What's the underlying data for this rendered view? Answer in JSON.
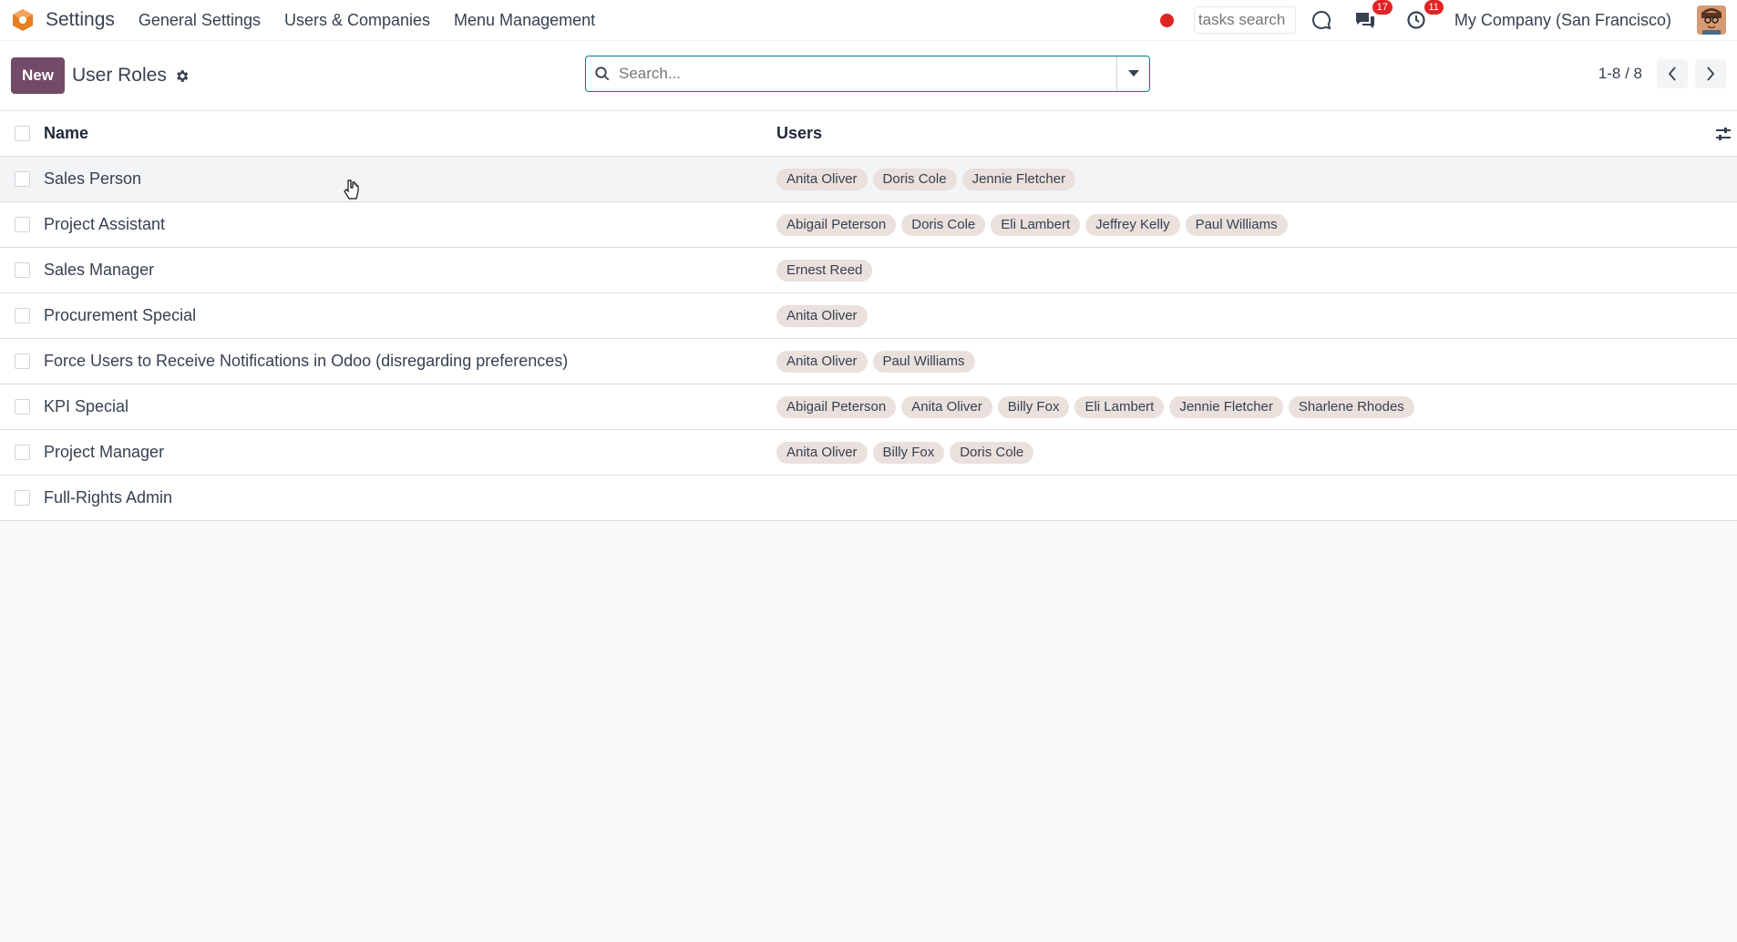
{
  "navbar": {
    "app_name": "Settings",
    "menu": [
      "General Settings",
      "Users & Companies",
      "Menu Management"
    ],
    "tasks_search_placeholder": "tasks search",
    "messages_badge": "17",
    "activities_badge": "11",
    "company": "My Company (San Francisco)"
  },
  "control": {
    "new_label": "New",
    "title": "User Roles",
    "search_placeholder": "Search...",
    "pager": "1-8 / 8"
  },
  "table": {
    "columns": [
      "Name",
      "Users"
    ],
    "rows": [
      {
        "name": "Sales Person",
        "users": [
          "Anita Oliver",
          "Doris Cole",
          "Jennie Fletcher"
        ]
      },
      {
        "name": "Project Assistant",
        "users": [
          "Abigail Peterson",
          "Doris Cole",
          "Eli Lambert",
          "Jeffrey Kelly",
          "Paul Williams"
        ]
      },
      {
        "name": "Sales Manager",
        "users": [
          "Ernest Reed"
        ]
      },
      {
        "name": "Procurement Special",
        "users": [
          "Anita Oliver"
        ]
      },
      {
        "name": "Force Users to Receive Notifications in Odoo (disregarding preferences)",
        "users": [
          "Anita Oliver",
          "Paul Williams"
        ]
      },
      {
        "name": "KPI Special",
        "users": [
          "Abigail Peterson",
          "Anita Oliver",
          "Billy Fox",
          "Eli Lambert",
          "Jennie Fletcher",
          "Sharlene Rhodes"
        ]
      },
      {
        "name": "Project Manager",
        "users": [
          "Anita Oliver",
          "Billy Fox",
          "Doris Cole"
        ]
      },
      {
        "name": "Full-Rights Admin",
        "users": []
      }
    ]
  }
}
